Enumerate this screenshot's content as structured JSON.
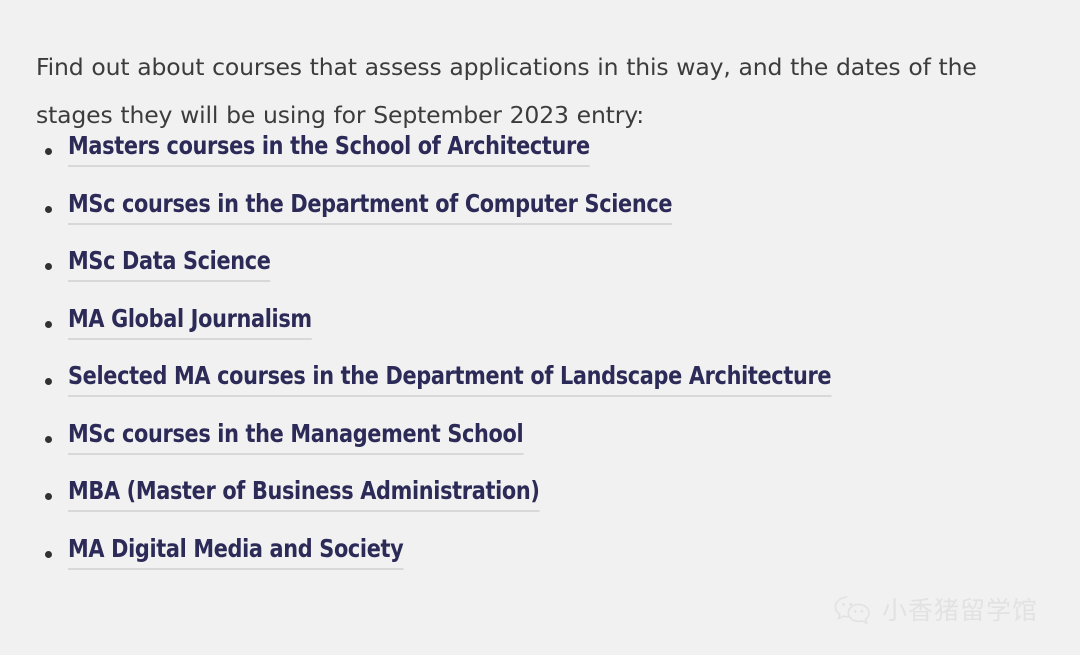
{
  "page": {
    "background_color": "#f1f1f1",
    "bottom_strip_color": "#ffffff"
  },
  "intro": {
    "paragraph": "Find out about courses that assess applications in this way, and the dates of the stages they will be using for September 2023 entry:"
  },
  "course_list": {
    "link_color": "#2c2a57",
    "underline_color": "#d8d8d8",
    "bullet_color": "#323232",
    "items": [
      {
        "label": "Masters courses in the School of Architecture"
      },
      {
        "label": "MSc courses in the Department of Computer Science"
      },
      {
        "label": "MSc Data Science"
      },
      {
        "label": "MA Global Journalism"
      },
      {
        "label": "Selected MA courses in the Department of Landscape Architecture"
      },
      {
        "label": "MSc courses in the Management School"
      },
      {
        "label": "MBA (Master of Business Administration)"
      },
      {
        "label": "MA Digital Media and Society"
      }
    ]
  },
  "watermark": {
    "icon": "wechat-icon",
    "text": "小香猪留学馆",
    "color": "#e2e2e2"
  }
}
